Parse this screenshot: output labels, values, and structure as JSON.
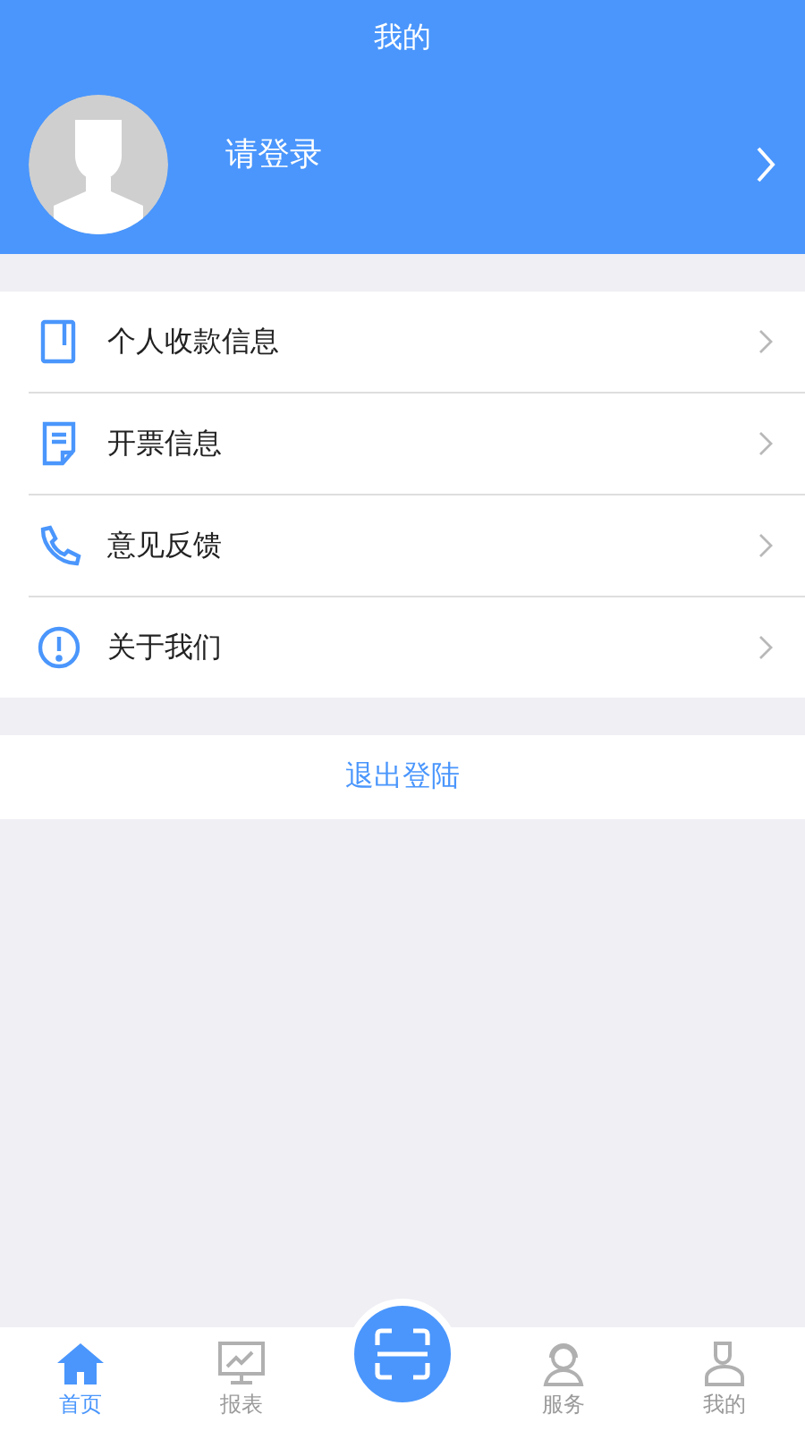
{
  "header": {
    "title": "我的"
  },
  "profile": {
    "login_prompt": "请登录"
  },
  "menu": [
    {
      "label": "个人收款信息"
    },
    {
      "label": "开票信息"
    },
    {
      "label": "意见反馈"
    },
    {
      "label": "关于我们"
    }
  ],
  "logout": {
    "label": "退出登陆"
  },
  "tab_bar": [
    {
      "kind": "tab",
      "label": "首页",
      "selected": true
    },
    {
      "kind": "tab",
      "label": "报表",
      "selected": false
    },
    {
      "kind": "scan",
      "selected": false
    },
    {
      "kind": "tab",
      "label": "服务",
      "selected": false
    },
    {
      "kind": "tab",
      "label": "我的",
      "selected": false
    }
  ]
}
